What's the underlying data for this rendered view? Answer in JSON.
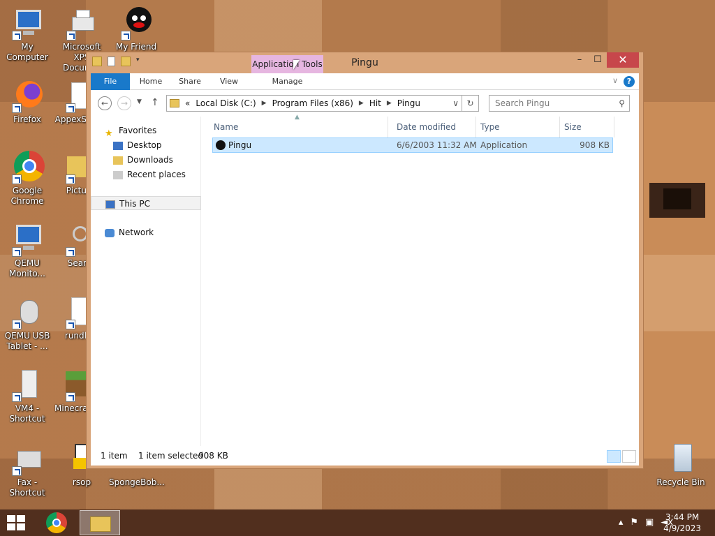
{
  "desktop": {
    "icons": [
      {
        "label": "My Computer"
      },
      {
        "label": "Microsoft XPS Docum..."
      },
      {
        "label": "My Friend"
      },
      {
        "label": "Firefox"
      },
      {
        "label": "AppexS"
      },
      {
        "label": "Google Chrome"
      },
      {
        "label": "Pictu"
      },
      {
        "label": "QEMU Monito..."
      },
      {
        "label": "Sear"
      },
      {
        "label": "QEMU USB Tablet - ..."
      },
      {
        "label": "rundl"
      },
      {
        "label": "VM4 - Shortcut"
      },
      {
        "label": "Minecra"
      },
      {
        "label": "Fax - Shortcut"
      },
      {
        "label": "rsop"
      },
      {
        "label": "SpongeBob..."
      },
      {
        "label": "Recycle Bin"
      }
    ]
  },
  "window": {
    "title": "Pingu",
    "context_tab": "Application Tools",
    "ribbon_tabs": [
      "File",
      "Home",
      "Share",
      "View",
      "Manage"
    ],
    "address": {
      "prefix": "«",
      "crumbs": [
        "Local Disk (C:)",
        "Program Files (x86)",
        "Hit",
        "Pingu"
      ]
    },
    "search_placeholder": "Search Pingu",
    "nav": {
      "favorites": "Favorites",
      "desktop": "Desktop",
      "downloads": "Downloads",
      "recent": "Recent places",
      "this_pc": "This PC",
      "network": "Network"
    },
    "columns": [
      "Name",
      "Date modified",
      "Type",
      "Size"
    ],
    "files": [
      {
        "name": "Pingu",
        "date": "6/6/2003 11:32 AM",
        "type": "Application",
        "size": "908 KB"
      }
    ],
    "status": {
      "count": "1 item",
      "selected": "1 item selected",
      "size": "908 KB"
    }
  },
  "taskbar": {
    "time": "3:44 PM",
    "date": "4/9/2023"
  }
}
